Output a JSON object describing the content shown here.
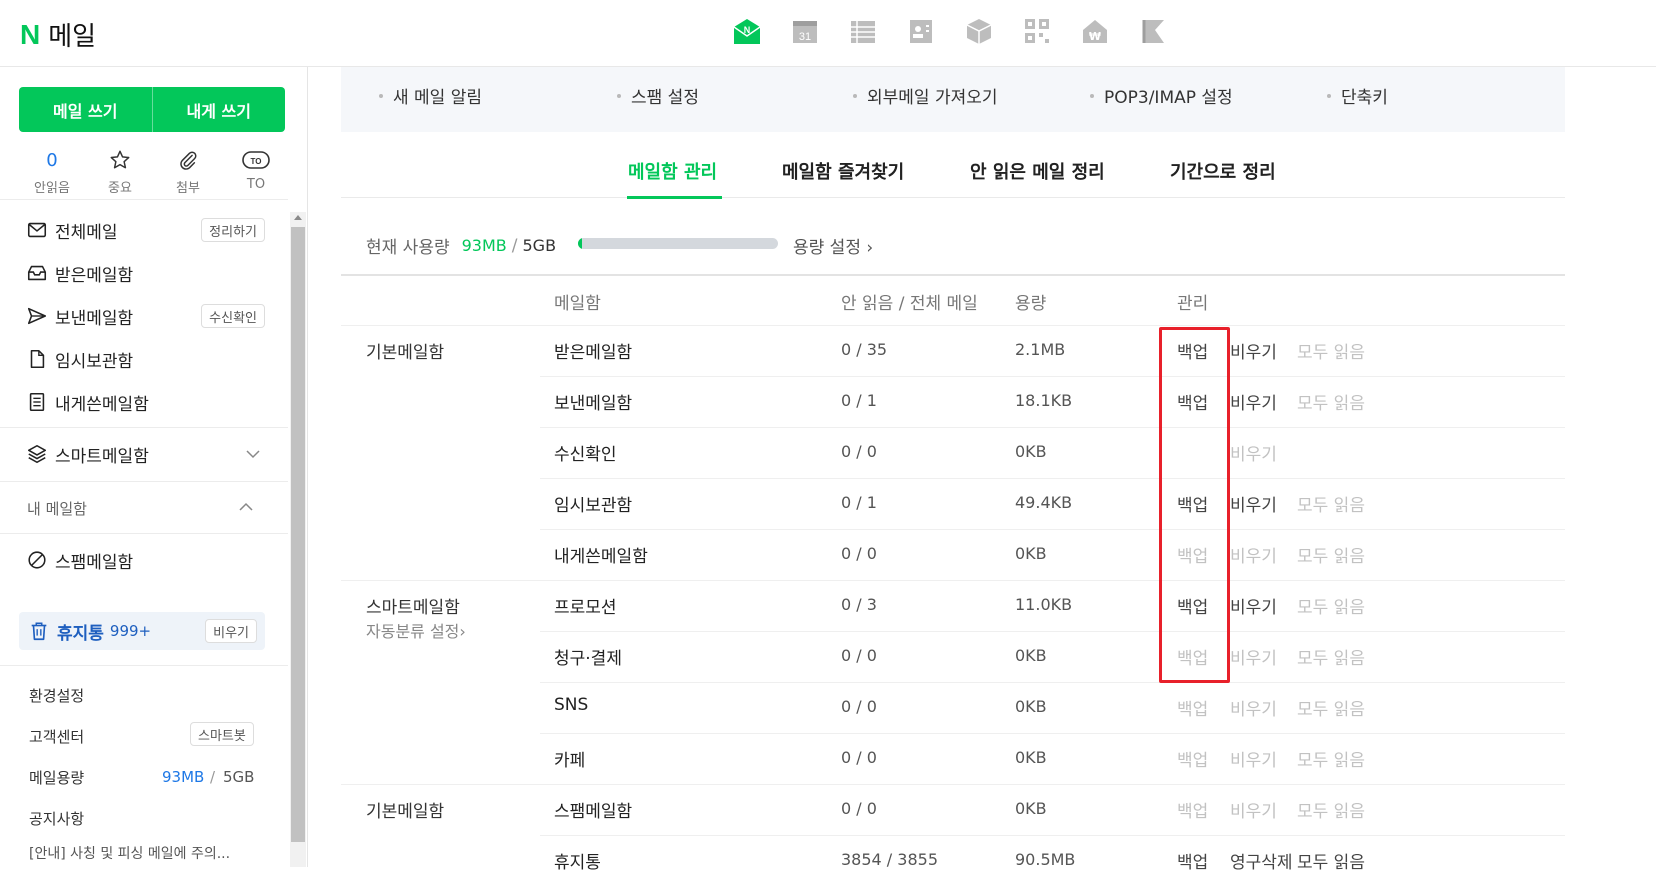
{
  "header": {
    "logo_letter": "N",
    "title": "메일",
    "apps": [
      {
        "name": "mail",
        "label": "N"
      },
      {
        "name": "calendar",
        "label": "31"
      },
      {
        "name": "list"
      },
      {
        "name": "contacts"
      },
      {
        "name": "box"
      },
      {
        "name": "qr"
      },
      {
        "name": "pay",
        "label": "₩"
      },
      {
        "name": "flag"
      }
    ]
  },
  "sidebar": {
    "write_label": "메일 쓰기",
    "self_write_label": "내게 쓰기",
    "quick": [
      {
        "label": "안읽음",
        "value": "0"
      },
      {
        "label": "중요"
      },
      {
        "label": "첨부"
      },
      {
        "label": "TO",
        "icon_text": "TO"
      }
    ],
    "nav": [
      {
        "label": "전체메일",
        "badge": "정리하기"
      },
      {
        "label": "받은메일함"
      },
      {
        "label": "보낸메일함",
        "badge": "수신확인"
      },
      {
        "label": "임시보관함"
      },
      {
        "label": "내게쓴메일함"
      }
    ],
    "smart_label": "스마트메일함",
    "my_box_title": "내 메일함",
    "spam_label": "스팸메일함",
    "trash": {
      "label": "휴지통",
      "count": "999+",
      "badge": "비우기"
    },
    "settings_label": "환경설정",
    "support_label": "고객센터",
    "support_badge": "스마트봇",
    "capacity_label": "메일용량",
    "capacity_used": "93MB",
    "capacity_total": "5GB",
    "notice_label": "공지사항",
    "notice_text": "[안내] 사칭 및 피싱 메일에 주의..."
  },
  "settings_links": [
    "새 메일 알림",
    "스팸 설정",
    "외부메일 가져오기",
    "POP3/IMAP 설정",
    "단축키"
  ],
  "tabs": [
    "메일함 관리",
    "메일함 즐겨찾기",
    "안 읽은 메일 정리",
    "기간으로 정리"
  ],
  "usage": {
    "label": "현재 사용량",
    "used": "93MB",
    "total": "5GB",
    "ratio": 0.018,
    "link": "용량 설정 ›"
  },
  "table": {
    "headers": [
      "메일함",
      "안 읽음 / 전체 메일",
      "용량",
      "관리"
    ],
    "rows": [
      {
        "group": "기본메일함",
        "name": "받은메일함",
        "count": "0 / 35",
        "size": "2.1MB",
        "backup": "백업",
        "backup_on": true,
        "empty": "비우기",
        "empty_on": true,
        "readall": "모두 읽음",
        "readall_on": false
      },
      {
        "group": "",
        "name": "보낸메일함",
        "count": "0 / 1",
        "size": "18.1KB",
        "backup": "백업",
        "backup_on": true,
        "empty": "비우기",
        "empty_on": true,
        "readall": "모두 읽음",
        "readall_on": false
      },
      {
        "group": "",
        "name": "수신확인",
        "count": "0 / 0",
        "size": "0KB",
        "backup": "",
        "backup_on": false,
        "empty": "비우기",
        "empty_on": false,
        "readall": "",
        "readall_on": false
      },
      {
        "group": "",
        "name": "임시보관함",
        "count": "0 / 1",
        "size": "49.4KB",
        "backup": "백업",
        "backup_on": true,
        "empty": "비우기",
        "empty_on": true,
        "readall": "모두 읽음",
        "readall_on": false
      },
      {
        "group": "",
        "name": "내게쓴메일함",
        "count": "0 / 0",
        "size": "0KB",
        "backup": "백업",
        "backup_on": false,
        "empty": "비우기",
        "empty_on": false,
        "readall": "모두 읽음",
        "readall_on": false
      },
      {
        "group": "스마트메일함",
        "sub": "자동분류 설정›",
        "name": "프로모션",
        "count": "0 / 3",
        "size": "11.0KB",
        "backup": "백업",
        "backup_on": true,
        "empty": "비우기",
        "empty_on": true,
        "readall": "모두 읽음",
        "readall_on": false
      },
      {
        "group": "",
        "name": "청구·결제",
        "count": "0 / 0",
        "size": "0KB",
        "backup": "백업",
        "backup_on": false,
        "empty": "비우기",
        "empty_on": false,
        "readall": "모두 읽음",
        "readall_on": false
      },
      {
        "group": "",
        "name": "SNS",
        "count": "0 / 0",
        "size": "0KB",
        "backup": "백업",
        "backup_on": false,
        "empty": "비우기",
        "empty_on": false,
        "readall": "모두 읽음",
        "readall_on": false
      },
      {
        "group": "",
        "name": "카페",
        "count": "0 / 0",
        "size": "0KB",
        "backup": "백업",
        "backup_on": false,
        "empty": "비우기",
        "empty_on": false,
        "readall": "모두 읽음",
        "readall_on": false
      },
      {
        "group": "기본메일함",
        "name": "스팸메일함",
        "count": "0 / 0",
        "size": "0KB",
        "backup": "백업",
        "backup_on": false,
        "empty": "비우기",
        "empty_on": false,
        "readall": "모두 읽음",
        "readall_on": false
      },
      {
        "group": "",
        "name": "휴지통",
        "count": "3854 / 3855",
        "size": "90.5MB",
        "backup": "백업",
        "backup_on": true,
        "empty": "영구삭제",
        "empty_on": true,
        "readall": "모두 읽음",
        "readall_on": true
      }
    ]
  },
  "colors": {
    "brand": "#03c75a",
    "highlight": "#e8202a",
    "link_blue": "#1e78e6"
  }
}
